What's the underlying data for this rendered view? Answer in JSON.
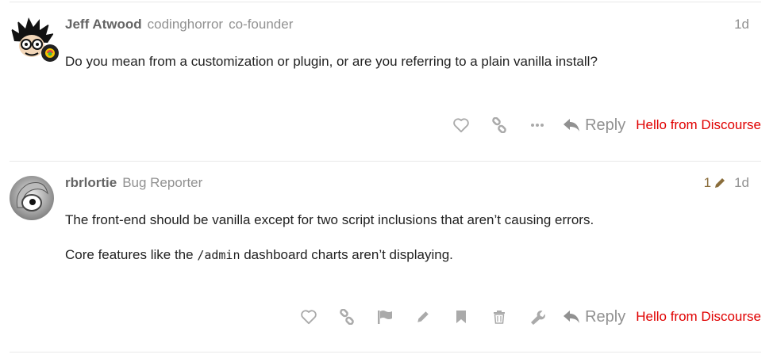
{
  "posts": [
    {
      "username": "Jeff Atwood",
      "fullname": "codinghorror",
      "title": "co-founder",
      "age": "1d",
      "paragraphs": [
        "Do you mean from a customization or plugin, or are you referring to a plain vanilla install?"
      ],
      "actions": [
        "like-icon",
        "link-icon",
        "more-icon"
      ],
      "reply_label": "Reply",
      "plugin_text": "Hello from Discourse"
    },
    {
      "username": "rbrlortie",
      "title": "Bug Reporter",
      "edit_count": "1",
      "age": "1d",
      "paragraphs": [
        "The front-end should be vanilla except for two script inclusions that aren’t causing errors."
      ],
      "p2_before": "Core features like the ",
      "p2_code": "/admin",
      "p2_after": " dashboard charts aren’t displaying.",
      "actions": [
        "like-icon",
        "link-icon",
        "flag-icon",
        "edit-icon",
        "bookmark-icon",
        "trash-icon",
        "wrench-icon"
      ],
      "reply_label": "Reply",
      "plugin_text": "Hello from Discourse"
    }
  ],
  "colors": {
    "plugin_text": "#e00000",
    "muted": "#919191",
    "edit_badge": "#8a6d3b"
  }
}
